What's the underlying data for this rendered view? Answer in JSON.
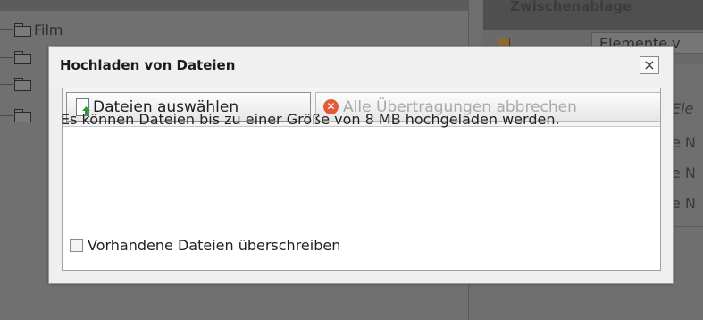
{
  "background": {
    "tree_items": [
      {
        "label": "Film"
      },
      {
        "label": ""
      },
      {
        "label": ""
      },
      {
        "label": ""
      }
    ],
    "right_panel": {
      "header": "Zwischenablage",
      "select_value": "Elemente v",
      "italic_fragment": "Ele",
      "row_fragments": [
        "e N",
        "e N",
        "e N"
      ]
    }
  },
  "dialog": {
    "title": "Hochladen von Dateien",
    "close_glyph": "×",
    "toolbar": {
      "choose_files_label": "Dateien auswählen",
      "cancel_all_label": "Alle Übertragungen abbrechen"
    },
    "info_text": "Es können Dateien bis zu einer Größe von 8 MB hochgeladen werden.",
    "overwrite_label": "Vorhandene Dateien überschreiben",
    "overwrite_checked": false
  },
  "colors": {
    "overlay": "#6e6e6e",
    "dialog_bg": "#efefef",
    "cancel_icon": "#e35a3a",
    "upload_arrow": "#2f9a2f"
  },
  "icons": {
    "choose_files": "document-upload-icon",
    "cancel_all": "cancel-circle-icon",
    "folder": "folder-icon",
    "close": "close-icon"
  }
}
